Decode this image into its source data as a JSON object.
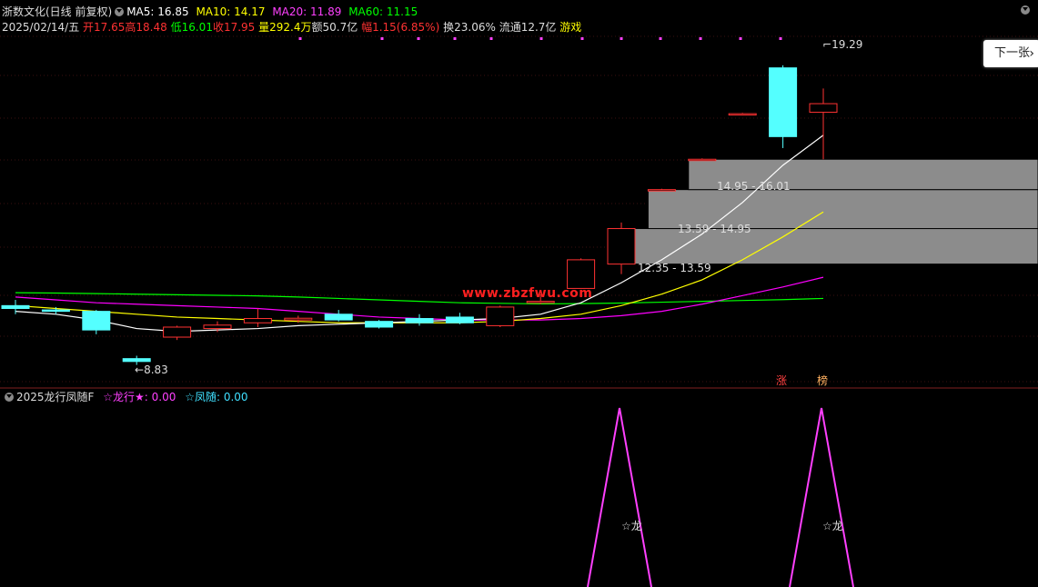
{
  "header": {
    "stock_name": "浙数文化(日线 前复权)",
    "ma5": "MA5: 16.85",
    "ma10": "MA10: 14.17",
    "ma20": "MA20: 11.89",
    "ma60": "MA60: 11.15",
    "date": "2025/02/14/五",
    "open": "开17.65",
    "high": "高18.48",
    "low": "低16.01",
    "close": "收17.95",
    "volume": "量292.4万",
    "amount": "额50.7亿",
    "change": "幅1.15(6.85%)",
    "turnover": "换23.06%",
    "float_cap": "流通12.7亿",
    "sector": "游戏"
  },
  "next_button": {
    "label": "下一张",
    "chevron": "›"
  },
  "price_labels": {
    "high_mark": "19.29",
    "low_mark": "8.83",
    "zone1": "14.95 - 16.01",
    "zone2": "13.59 - 14.95",
    "zone3": "12.35 - 13.59"
  },
  "badges": {
    "limit_up": "涨",
    "dragon_tiger": "榜"
  },
  "watermark": "www.zbzfwu.com",
  "indicator": {
    "name": "2025龙行凤随F",
    "line1": "☆龙行★: 0.00",
    "line2": "☆凤随: 0.00",
    "peak_label1": "☆龙",
    "peak_label2": "☆龙"
  },
  "colors": {
    "up": "#ff3232",
    "down": "#54ffff",
    "ma5": "#ffffff",
    "ma10": "#ffff00",
    "ma20": "#ff00ff",
    "ma60": "#00ff00",
    "zone": "#8c8c8c",
    "indicator": "#ff40ff"
  },
  "chart_data": {
    "type": "candlestick",
    "candles": [
      {
        "o": 10.9,
        "h": 11.1,
        "l": 10.6,
        "c": 10.8
      },
      {
        "o": 10.75,
        "h": 10.85,
        "l": 10.6,
        "c": 10.7
      },
      {
        "o": 10.7,
        "h": 10.75,
        "l": 9.9,
        "c": 10.05
      },
      {
        "o": 9.05,
        "h": 9.15,
        "l": 8.83,
        "c": 8.95
      },
      {
        "o": 9.8,
        "h": 10.2,
        "l": 9.7,
        "c": 10.15
      },
      {
        "o": 10.1,
        "h": 10.35,
        "l": 9.98,
        "c": 10.22
      },
      {
        "o": 10.3,
        "h": 10.8,
        "l": 10.15,
        "c": 10.45
      },
      {
        "o": 10.4,
        "h": 10.55,
        "l": 10.3,
        "c": 10.46
      },
      {
        "o": 10.6,
        "h": 10.75,
        "l": 10.35,
        "c": 10.4
      },
      {
        "o": 10.35,
        "h": 10.4,
        "l": 10.1,
        "c": 10.15
      },
      {
        "o": 10.45,
        "h": 10.6,
        "l": 10.2,
        "c": 10.3
      },
      {
        "o": 10.5,
        "h": 10.65,
        "l": 10.25,
        "c": 10.3
      },
      {
        "o": 10.2,
        "h": 10.9,
        "l": 10.15,
        "c": 10.85
      },
      {
        "o": 11.0,
        "h": 11.3,
        "l": 10.95,
        "c": 11.05
      },
      {
        "o": 11.5,
        "h": 12.55,
        "l": 11.5,
        "c": 12.5
      },
      {
        "o": 12.35,
        "h": 13.8,
        "l": 12.0,
        "c": 13.59
      },
      {
        "o": 14.95,
        "h": 14.98,
        "l": 14.92,
        "c": 14.95
      },
      {
        "o": 16.01,
        "h": 16.04,
        "l": 15.98,
        "c": 16.01
      },
      {
        "o": 17.6,
        "h": 17.63,
        "l": 17.57,
        "c": 17.6
      },
      {
        "o": 19.2,
        "h": 19.29,
        "l": 16.4,
        "c": 16.8
      },
      {
        "o": 17.65,
        "h": 18.48,
        "l": 16.01,
        "c": 17.95
      }
    ],
    "zones": [
      {
        "from": 12.35,
        "to": 13.59,
        "startIndex": 15
      },
      {
        "from": 13.59,
        "to": 14.95,
        "startIndex": 16
      },
      {
        "from": 14.95,
        "to": 16.01,
        "startIndex": 17
      }
    ],
    "ma5": [
      10.7,
      10.6,
      10.4,
      10.1,
      10.0,
      10.05,
      10.1,
      10.2,
      10.25,
      10.3,
      10.35,
      10.4,
      10.45,
      10.6,
      11.0,
      11.7,
      12.5,
      13.4,
      14.5,
      15.8,
      16.85
    ],
    "ma10": [
      10.9,
      10.8,
      10.7,
      10.6,
      10.5,
      10.45,
      10.4,
      10.35,
      10.3,
      10.3,
      10.3,
      10.3,
      10.35,
      10.45,
      10.6,
      10.9,
      11.3,
      11.8,
      12.5,
      13.3,
      14.17
    ],
    "ma20": [
      11.2,
      11.1,
      11.0,
      10.95,
      10.9,
      10.85,
      10.8,
      10.7,
      10.6,
      10.5,
      10.45,
      10.4,
      10.4,
      10.4,
      10.45,
      10.55,
      10.7,
      10.95,
      11.25,
      11.55,
      11.89
    ],
    "ma60": [
      11.35,
      11.34,
      11.32,
      11.3,
      11.28,
      11.26,
      11.24,
      11.2,
      11.15,
      11.1,
      11.05,
      11.0,
      10.98,
      10.96,
      10.97,
      10.99,
      11.02,
      11.05,
      11.08,
      11.11,
      11.15
    ],
    "indicator_peaks": [
      15,
      20
    ],
    "ylim": [
      8.5,
      20.3
    ]
  }
}
